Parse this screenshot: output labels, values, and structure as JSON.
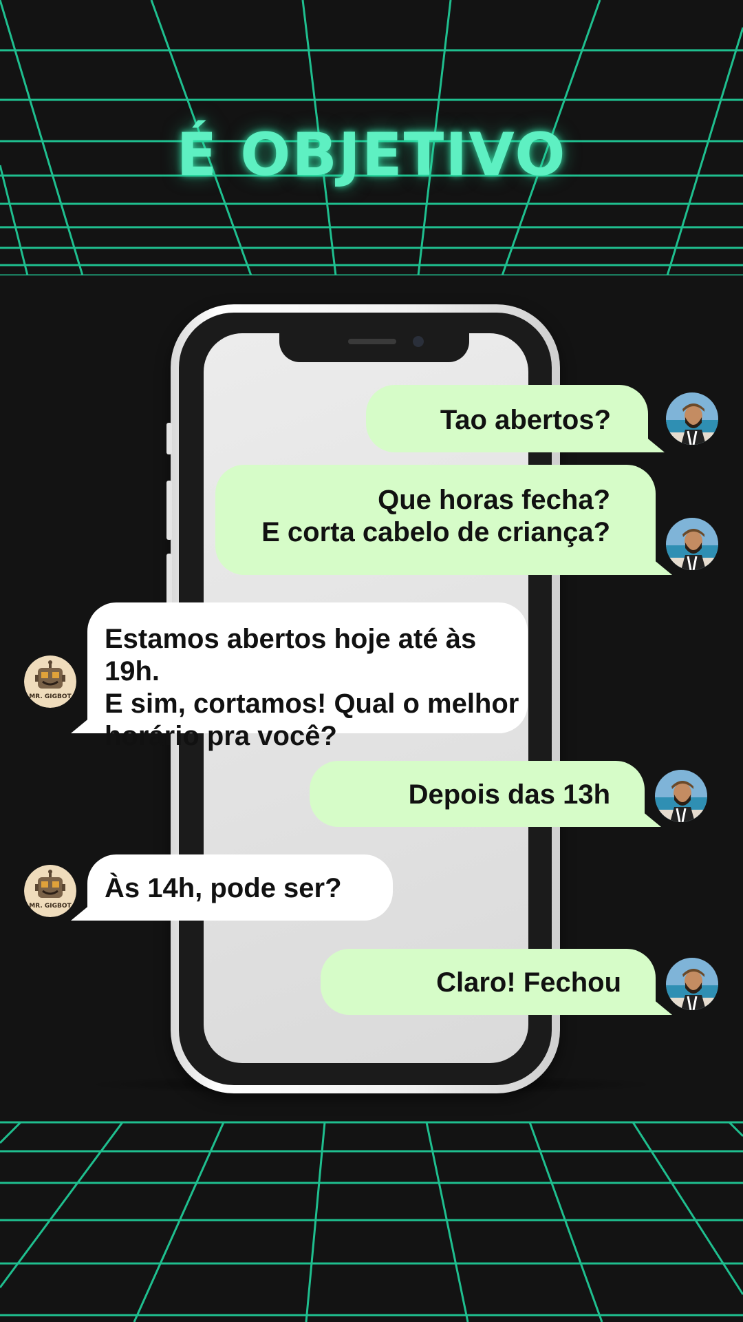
{
  "headline": "É OBJETIVO",
  "colors": {
    "background": "#131313",
    "grid_line": "#1fbf8f",
    "headline": "#5ef0c2",
    "user_bubble": "#d6fcc8",
    "bot_bubble": "#ffffff"
  },
  "bot": {
    "avatar_label": "MR. GIGBOT",
    "avatar_icon": "robot-face-icon"
  },
  "user": {
    "avatar_icon": "bearded-man-photo-avatar"
  },
  "messages": [
    {
      "sender": "user",
      "lines": [
        "Tao abertos?"
      ]
    },
    {
      "sender": "user",
      "lines": [
        "Que horas fecha?",
        "E corta cabelo de criança?"
      ]
    },
    {
      "sender": "bot",
      "lines": [
        "Estamos abertos hoje até às 19h.",
        "E sim, cortamos! Qual o melhor",
        "horário pra você?"
      ]
    },
    {
      "sender": "user",
      "lines": [
        "Depois das 13h"
      ]
    },
    {
      "sender": "bot",
      "lines": [
        "Às 14h, pode ser?"
      ]
    },
    {
      "sender": "user",
      "lines": [
        "Claro! Fechou"
      ]
    }
  ]
}
